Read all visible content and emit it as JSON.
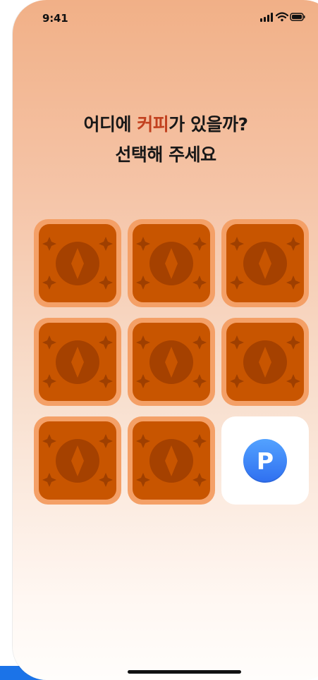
{
  "status_bar": {
    "time": "9:41",
    "signal_icon": "cellular-signal-icon",
    "wifi_icon": "wifi-icon",
    "battery_icon": "battery-icon"
  },
  "prompt": {
    "line1_before": "어디에 ",
    "line1_highlight": "커피",
    "line1_after": "가 있을까?",
    "line2": "선택해 주세요"
  },
  "grid": {
    "tiles": [
      {
        "state": "hidden"
      },
      {
        "state": "hidden"
      },
      {
        "state": "hidden"
      },
      {
        "state": "hidden"
      },
      {
        "state": "hidden"
      },
      {
        "state": "hidden"
      },
      {
        "state": "hidden"
      },
      {
        "state": "hidden"
      },
      {
        "state": "revealed",
        "content": "P"
      }
    ]
  },
  "colors": {
    "tile_border": "#f4a067",
    "tile_face": "#c85500",
    "coin_blue": "#2f6ff0",
    "highlight_red": "#c2411f"
  }
}
